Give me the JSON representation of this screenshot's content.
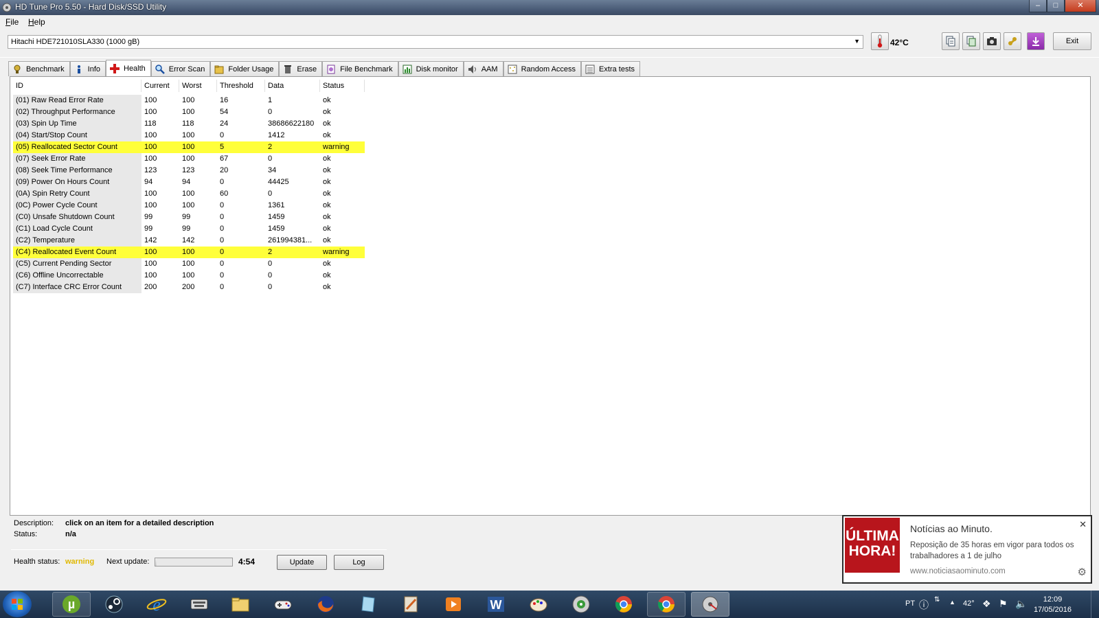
{
  "window": {
    "title": "HD Tune Pro 5.50 - Hard Disk/SSD Utility",
    "buttons": [
      "minimize-icon",
      "maximize-icon",
      "close-icon"
    ]
  },
  "menu": {
    "file": "File",
    "help": "Help"
  },
  "toolbar": {
    "drive": "Hitachi HDE721010SLA330 (1000 gB)",
    "temperature": "42°C",
    "exit_label": "Exit",
    "icons": [
      "copy-text-icon",
      "copy-screen-icon",
      "camera-icon",
      "options-icon",
      "download-icon"
    ]
  },
  "tabs": [
    {
      "label": "Benchmark",
      "icon": "benchmark-icon"
    },
    {
      "label": "Info",
      "icon": "info-icon"
    },
    {
      "label": "Health",
      "icon": "health-cross-icon"
    },
    {
      "label": "Error Scan",
      "icon": "magnifier-icon"
    },
    {
      "label": "Folder Usage",
      "icon": "folder-icon"
    },
    {
      "label": "Erase",
      "icon": "trash-icon"
    },
    {
      "label": "File Benchmark",
      "icon": "file-benchmark-icon"
    },
    {
      "label": "Disk monitor",
      "icon": "disk-monitor-icon"
    },
    {
      "label": "AAM",
      "icon": "speaker-icon"
    },
    {
      "label": "Random Access",
      "icon": "random-access-icon"
    },
    {
      "label": "Extra tests",
      "icon": "extra-tests-icon"
    }
  ],
  "health": {
    "columns": [
      "ID",
      "Current",
      "Worst",
      "Threshold",
      "Data",
      "Status"
    ],
    "rows": [
      {
        "id": "(01) Raw Read Error Rate",
        "current": "100",
        "worst": "100",
        "threshold": "16",
        "data": "1",
        "status": "ok"
      },
      {
        "id": "(02) Throughput Performance",
        "current": "100",
        "worst": "100",
        "threshold": "54",
        "data": "0",
        "status": "ok"
      },
      {
        "id": "(03) Spin Up Time",
        "current": "118",
        "worst": "118",
        "threshold": "24",
        "data": "38686622180",
        "status": "ok"
      },
      {
        "id": "(04) Start/Stop Count",
        "current": "100",
        "worst": "100",
        "threshold": "0",
        "data": "1412",
        "status": "ok"
      },
      {
        "id": "(05) Reallocated Sector Count",
        "current": "100",
        "worst": "100",
        "threshold": "5",
        "data": "2",
        "status": "warning"
      },
      {
        "id": "(07) Seek Error Rate",
        "current": "100",
        "worst": "100",
        "threshold": "67",
        "data": "0",
        "status": "ok"
      },
      {
        "id": "(08) Seek Time Performance",
        "current": "123",
        "worst": "123",
        "threshold": "20",
        "data": "34",
        "status": "ok"
      },
      {
        "id": "(09) Power On Hours Count",
        "current": "94",
        "worst": "94",
        "threshold": "0",
        "data": "44425",
        "status": "ok"
      },
      {
        "id": "(0A) Spin Retry Count",
        "current": "100",
        "worst": "100",
        "threshold": "60",
        "data": "0",
        "status": "ok"
      },
      {
        "id": "(0C) Power Cycle Count",
        "current": "100",
        "worst": "100",
        "threshold": "0",
        "data": "1361",
        "status": "ok"
      },
      {
        "id": "(C0) Unsafe Shutdown Count",
        "current": "99",
        "worst": "99",
        "threshold": "0",
        "data": "1459",
        "status": "ok"
      },
      {
        "id": "(C1) Load Cycle Count",
        "current": "99",
        "worst": "99",
        "threshold": "0",
        "data": "1459",
        "status": "ok"
      },
      {
        "id": "(C2) Temperature",
        "current": "142",
        "worst": "142",
        "threshold": "0",
        "data": "261994381...",
        "status": "ok"
      },
      {
        "id": "(C4) Reallocated Event Count",
        "current": "100",
        "worst": "100",
        "threshold": "0",
        "data": "2",
        "status": "warning"
      },
      {
        "id": "(C5) Current Pending Sector",
        "current": "100",
        "worst": "100",
        "threshold": "0",
        "data": "0",
        "status": "ok"
      },
      {
        "id": "(C6) Offline Uncorrectable",
        "current": "100",
        "worst": "100",
        "threshold": "0",
        "data": "0",
        "status": "ok"
      },
      {
        "id": "(C7) Interface CRC Error Count",
        "current": "200",
        "worst": "200",
        "threshold": "0",
        "data": "0",
        "status": "ok"
      }
    ]
  },
  "description": {
    "desc_label": "Description:",
    "desc_value": "click on an item for a detailed description",
    "status_label": "Status:",
    "status_value": "n/a"
  },
  "footer": {
    "health_status_label": "Health status:",
    "health_status_value": "warning",
    "health_status_color": "#e0b800",
    "next_update_label": "Next update:",
    "next_update_time": "4:54",
    "next_update_progress": 0.02,
    "update_label": "Update",
    "log_label": "Log"
  },
  "notification": {
    "logo_line1": "ÚLTIMA",
    "logo_line2": "HORA!",
    "title": "Notícias ao Minuto.",
    "body": "Reposição de 35 horas em vigor para todos os trabalhadores a 1 de julho",
    "source": "www.noticiasaominuto.com"
  },
  "taskbar": {
    "apps": [
      "utorrent-icon",
      "steam-icon",
      "internet-explorer-icon",
      "keyboard-app-icon",
      "file-explorer-icon",
      "gamepad-icon",
      "firefox-icon",
      "notes-app-icon",
      "reader-app-icon",
      "media-player-icon",
      "word-icon",
      "paint-icon",
      "iso-tool-icon",
      "chrome-icon",
      "chrome-icon",
      "hdtune-icon"
    ],
    "lang": "PT",
    "tray_temp": "42°",
    "time": "12:09",
    "date": "17/05/2016"
  }
}
